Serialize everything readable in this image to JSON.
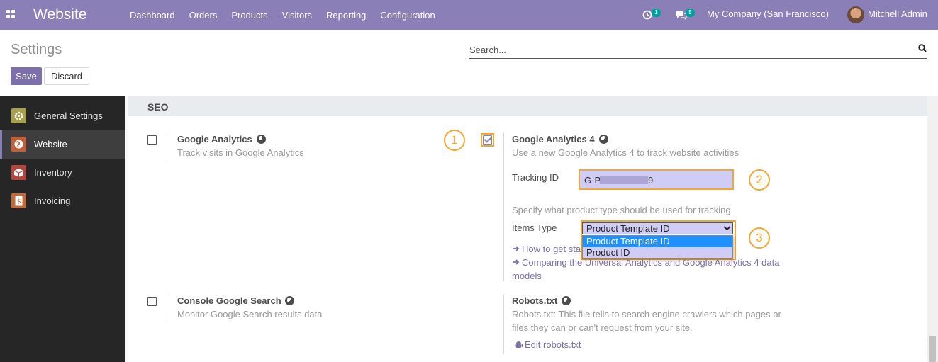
{
  "app": {
    "name": "Website"
  },
  "menu": [
    "Dashboard",
    "Orders",
    "Products",
    "Visitors",
    "Reporting",
    "Configuration"
  ],
  "systray": {
    "activity_count": "1",
    "messages_count": "5",
    "company": "My Company (San Francisco)",
    "user": "Mitchell Admin"
  },
  "control": {
    "title": "Settings",
    "search_placeholder": "Search...",
    "save_label": "Save",
    "discard_label": "Discard"
  },
  "sidebar": {
    "items": [
      {
        "label": "General Settings",
        "icon": "gear-icon",
        "color": "#a7a04d"
      },
      {
        "label": "Website",
        "icon": "globe-icon",
        "color": "#c05f3a"
      },
      {
        "label": "Inventory",
        "icon": "box-icon",
        "color": "#b0473f"
      },
      {
        "label": "Invoicing",
        "icon": "invoice-icon",
        "color": "#c06a3e"
      }
    ],
    "active": "Website"
  },
  "section": {
    "title": "SEO",
    "google_analytics": {
      "label": "Google Analytics",
      "desc": "Track visits in Google Analytics",
      "checked": false
    },
    "google_analytics_4": {
      "label": "Google Analytics 4",
      "desc": "Use a new Google Analytics 4 to track website activities",
      "checked": true,
      "tracking_label": "Tracking ID",
      "tracking_value_start": "G-P",
      "tracking_value_end": "9",
      "product_type_hint": "Specify what product type should be used for tracking",
      "items_type_label": "Items Type",
      "items_type_value": "Product Template ID",
      "items_type_options": [
        "Product Template ID",
        "Product ID"
      ],
      "link_howto": "How to get sta",
      "link_compare_1": "Comparing the Universal Analytics and Google Analytics 4 data",
      "link_compare_2": "models"
    },
    "console_google_search": {
      "label": "Console Google Search",
      "desc": "Monitor Google Search results data",
      "checked": false
    },
    "robots": {
      "label": "Robots.txt",
      "desc_1": "Robots.txt: This file tells to search engine crawlers which pages or",
      "desc_2": "files they can or can't request from your site.",
      "edit_link": "Edit robots.txt"
    }
  },
  "callouts": [
    "1",
    "2",
    "3"
  ],
  "colors": {
    "navbar": "#8a7fb6",
    "primary": "#7c6fab",
    "callout": "#f5a72f",
    "sidebar": "#262626"
  }
}
